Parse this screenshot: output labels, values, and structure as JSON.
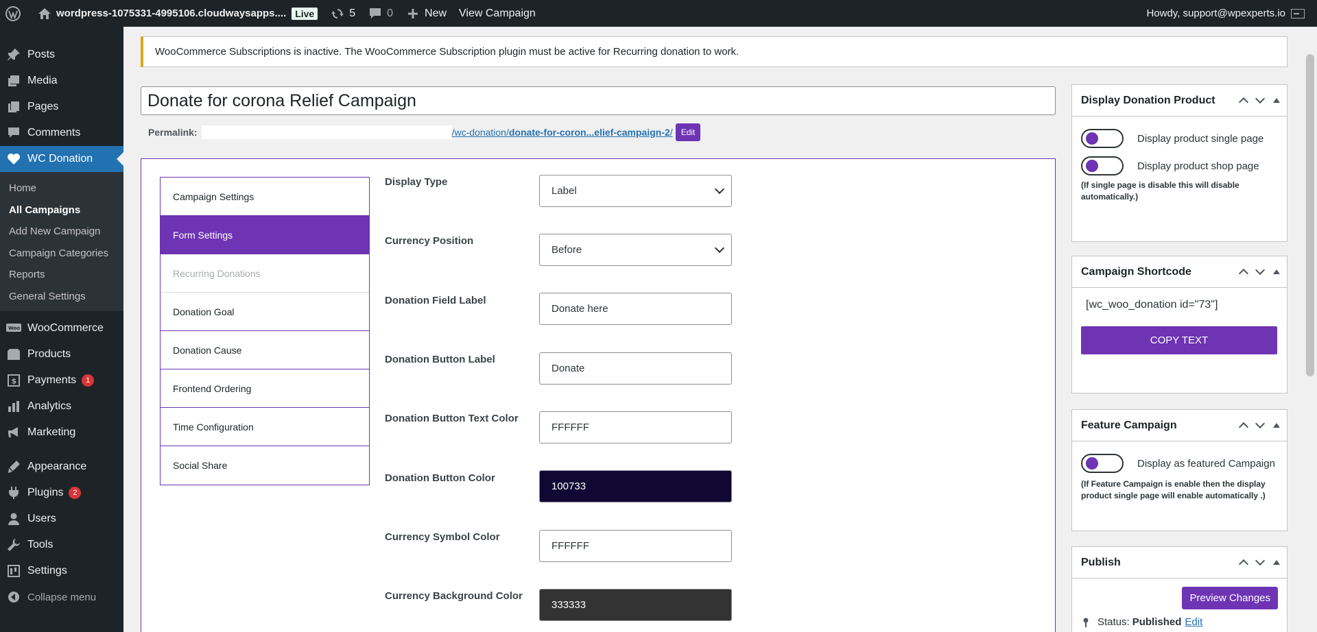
{
  "adminbar": {
    "site": "wordpress-1075331-4995106.cloudwaysapps....",
    "live": "Live",
    "updates": "5",
    "comments": "0",
    "new": "New",
    "view": "View Campaign",
    "howdy": "Howdy, support@wpexperts.io"
  },
  "sidebar": {
    "top": [
      {
        "label": "Posts",
        "icon": "pin-icon"
      },
      {
        "label": "Media",
        "icon": "media-icon"
      },
      {
        "label": "Pages",
        "icon": "pages-icon"
      },
      {
        "label": "Comments",
        "icon": "comments-icon"
      }
    ],
    "current": {
      "label": "WC Donation",
      "icon": "heart-icon"
    },
    "submenu": [
      {
        "label": "Home"
      },
      {
        "label": "All Campaigns"
      },
      {
        "label": "Add New Campaign"
      },
      {
        "label": "Campaign Categories"
      },
      {
        "label": "Reports"
      },
      {
        "label": "General Settings"
      }
    ],
    "bottom": [
      {
        "label": "WooCommerce",
        "icon": "woo-icon"
      },
      {
        "label": "Products",
        "icon": "products-icon"
      },
      {
        "label": "Payments",
        "icon": "payments-icon",
        "badge": "1"
      },
      {
        "label": "Analytics",
        "icon": "analytics-icon"
      },
      {
        "label": "Marketing",
        "icon": "marketing-icon"
      },
      {
        "label": "Appearance",
        "icon": "appearance-icon"
      },
      {
        "label": "Plugins",
        "icon": "plugins-icon",
        "badge": "2"
      },
      {
        "label": "Users",
        "icon": "users-icon"
      },
      {
        "label": "Tools",
        "icon": "tools-icon"
      },
      {
        "label": "Settings",
        "icon": "settings-icon"
      }
    ],
    "collapse": "Collapse menu"
  },
  "notice": "WooCommerce Subscriptions is inactive. The WooCommerce Subscription plugin must be active for Recurring donation to work.",
  "title": "Donate for corona Relief Campaign",
  "permalink": {
    "label": "Permalink:",
    "path": "/wc-donation/",
    "slug": "donate-for-coron...elief-campaign-2",
    "trail": "/",
    "edit": "Edit"
  },
  "tabs": [
    {
      "label": "Campaign Settings"
    },
    {
      "label": "Form Settings"
    },
    {
      "label": "Recurring Donations"
    },
    {
      "label": "Donation Goal"
    },
    {
      "label": "Donation Cause"
    },
    {
      "label": "Frontend Ordering"
    },
    {
      "label": "Time Configuration"
    },
    {
      "label": "Social Share"
    }
  ],
  "fields": [
    {
      "label": "Display Type",
      "value": "Label"
    },
    {
      "label": "Currency Position",
      "value": "Before"
    },
    {
      "label": "Donation Field Label",
      "value": "Donate here"
    },
    {
      "label": "Donation Button Label",
      "value": "Donate"
    },
    {
      "label": "Donation Button Text Color",
      "value": "FFFFFF"
    },
    {
      "label": "Donation Button Color",
      "value": "100733"
    },
    {
      "label": "Currency Symbol Color",
      "value": "FFFFFF"
    },
    {
      "label": "Currency Background Color",
      "value": "333333"
    }
  ],
  "boxes": {
    "display": {
      "title": "Display Donation Product",
      "single": "Display product single page",
      "shop": "Display product shop page",
      "note": "(If single page is disable this will disable automatically.)"
    },
    "shortcode": {
      "title": "Campaign Shortcode",
      "code": "[wc_woo_donation id=\"73\"]",
      "copy": "COPY TEXT"
    },
    "feature": {
      "title": "Feature Campaign",
      "toggle": "Display as featured Campaign",
      "note": "(If Feature Campaign is enable then the display product single page will enable automatically .)"
    },
    "publish": {
      "title": "Publish",
      "preview": "Preview Changes",
      "status_label": "Status:",
      "status_value": "Published",
      "edit": "Edit"
    }
  },
  "colors": {
    "accent": "#6e34b4",
    "admin_dark": "#1d2327",
    "wp_blue": "#2271b1",
    "button_color": "#100733",
    "currency_bg": "#333333"
  }
}
